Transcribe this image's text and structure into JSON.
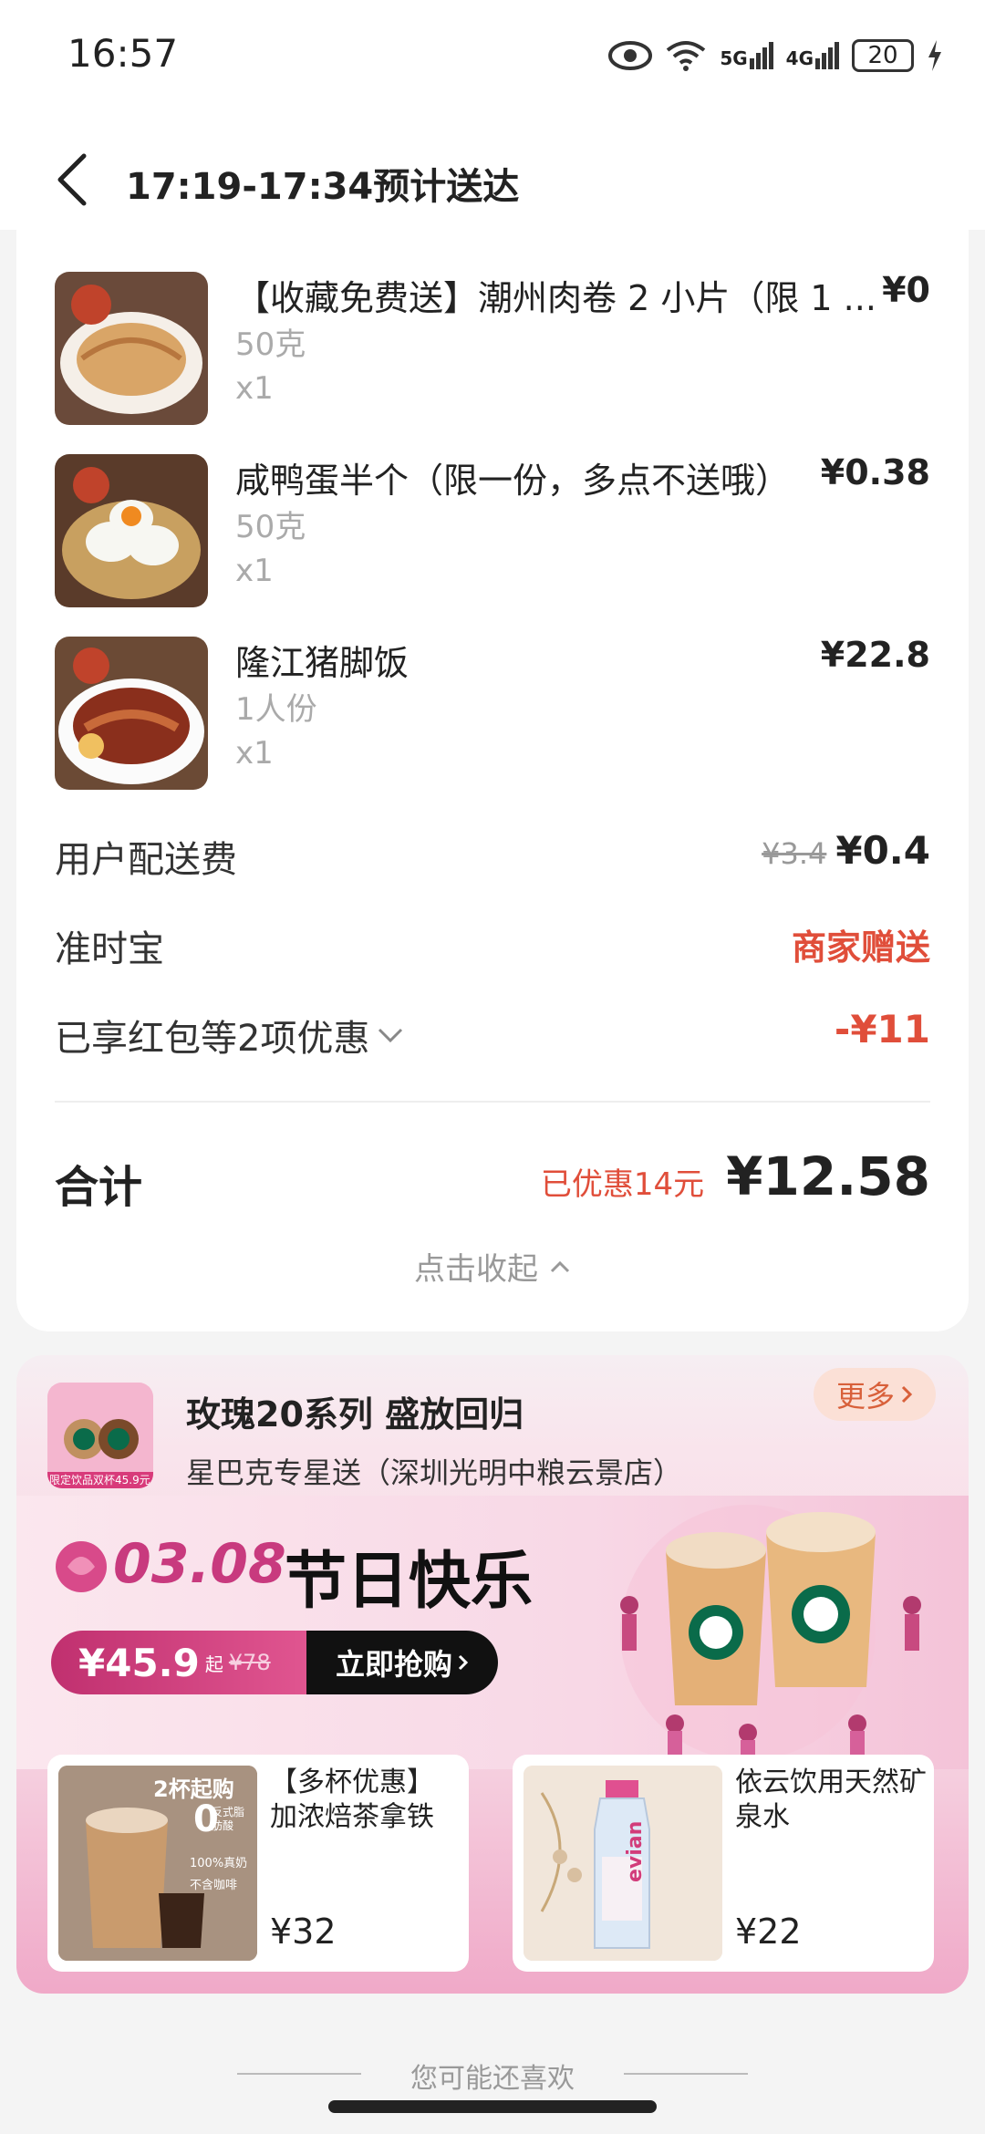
{
  "status": {
    "time": "16:57",
    "battery": "20",
    "net1": "5G",
    "net2": "4G"
  },
  "header": {
    "title": "17:19-17:34预计送达"
  },
  "items": [
    {
      "name": "【收藏免费送】潮州肉卷 2 小片（限 1 ...",
      "spec": "50克",
      "qty": "x1",
      "price": "¥0"
    },
    {
      "name": "咸鸭蛋半个（限一份，多点不送哦）",
      "spec": "50克",
      "qty": "x1",
      "price": "¥0.38"
    },
    {
      "name": "隆江猪脚饭",
      "spec": "1人份",
      "qty": "x1",
      "price": "¥22.8"
    }
  ],
  "fees": {
    "delivery_label": "用户配送费",
    "delivery_old": "¥3.4",
    "delivery_new": "¥0.4",
    "ontime_label": "准时宝",
    "ontime_value": "商家赠送",
    "discount_label": "已享红包等2项优惠",
    "discount_value": "-¥11"
  },
  "total": {
    "label": "合计",
    "saved": "已优惠14元",
    "amount": "¥12.58",
    "collapse": "点击收起"
  },
  "promo": {
    "title": "玫瑰20系列 盛放回归",
    "store": "星巴克专星送（深圳光明中粮云景店）",
    "more": "更多",
    "logo_tag": "限定饮品双杯45.9元",
    "banner_date": "03.08",
    "banner_text": "节日快乐",
    "price": "¥45.9",
    "price_from": "起",
    "price_old": "¥78",
    "cta": "立即抢购",
    "products": [
      {
        "name": "【多杯优惠】加浓焙茶拿铁",
        "price": "¥32",
        "tag": "2杯起购",
        "badge1": "0",
        "badge2": "反式脂肪酸",
        "badge3": "100%真奶",
        "badge4": "不含咖啡"
      },
      {
        "name": "依云饮用天然矿泉水",
        "price": "¥22",
        "bottle": "evian"
      }
    ]
  },
  "footer": {
    "more_text": "您可能还喜欢"
  }
}
